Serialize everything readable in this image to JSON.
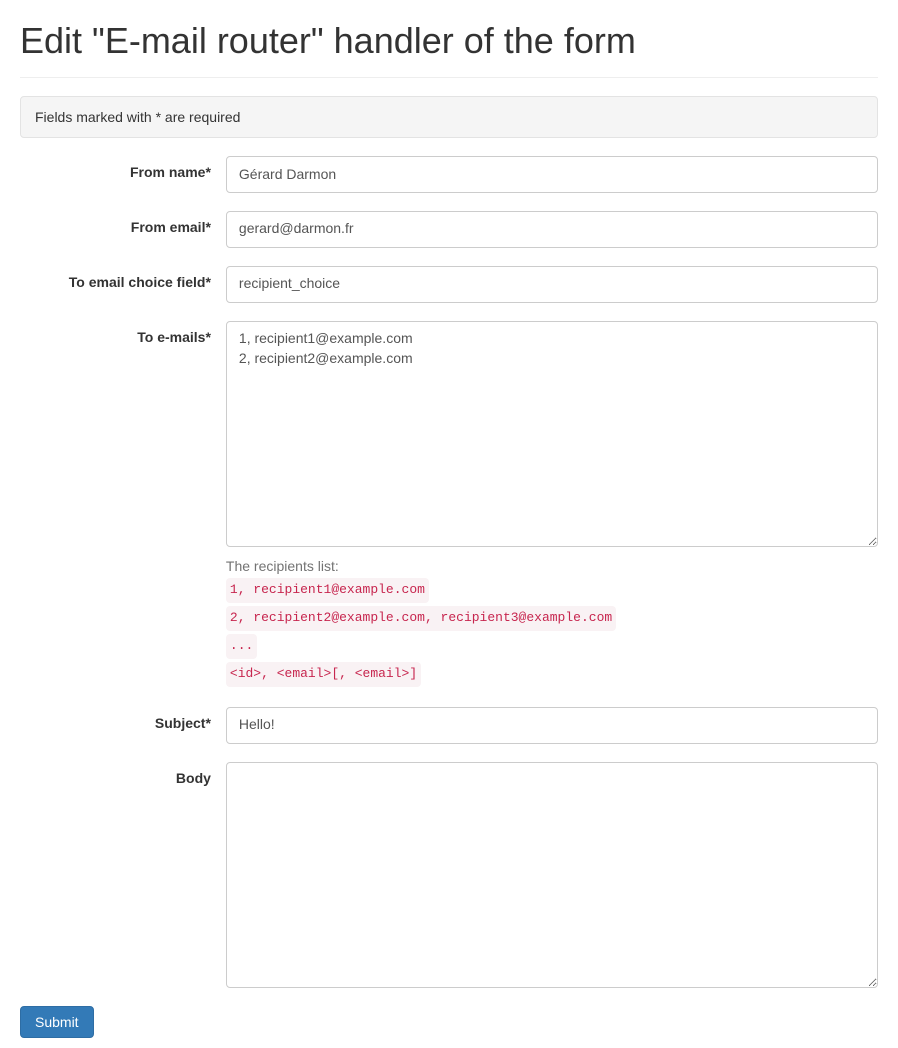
{
  "header": {
    "title": "Edit \"E-mail router\" handler of the form"
  },
  "notice": {
    "text": "Fields marked with * are required"
  },
  "form": {
    "from_name": {
      "label": "From name*",
      "value": "Gérard Darmon"
    },
    "from_email": {
      "label": "From email*",
      "value": "gerard@darmon.fr"
    },
    "to_email_choice_field": {
      "label": "To email choice field*",
      "value": "recipient_choice"
    },
    "to_emails": {
      "label": "To e-mails*",
      "value": "1, recipient1@example.com\n2, recipient2@example.com",
      "help_intro": "The recipients list:",
      "help_lines": [
        "1, recipient1@example.com",
        "2, recipient2@example.com, recipient3@example.com",
        "...",
        "<id>, <email>[, <email>]"
      ]
    },
    "subject": {
      "label": "Subject*",
      "value": "Hello!"
    },
    "body": {
      "label": "Body",
      "value": ""
    },
    "submit_label": "Submit"
  }
}
